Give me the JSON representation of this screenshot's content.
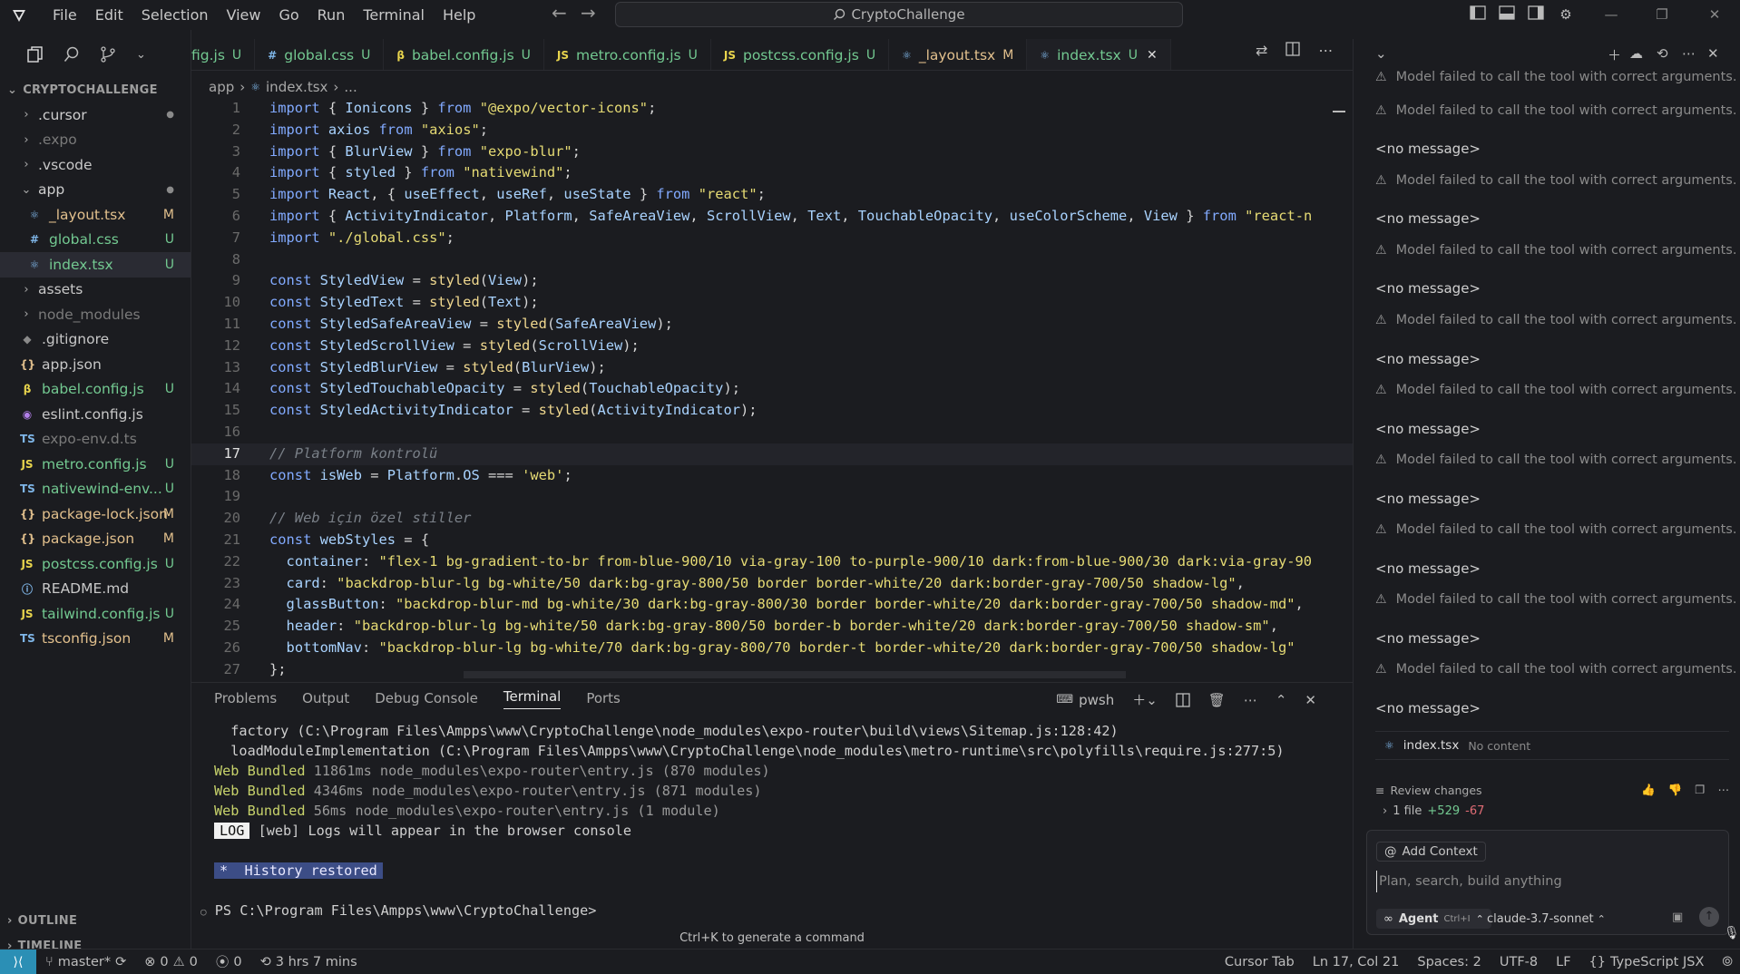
{
  "titlebar": {
    "menus": [
      "File",
      "Edit",
      "Selection",
      "View",
      "Go",
      "Run",
      "Terminal",
      "Help"
    ],
    "search_text": "CryptoChallenge"
  },
  "explorer": {
    "title": "CRYPTOCHALLENGE",
    "items": [
      {
        "label": ".cursor",
        "kind": "folder",
        "badge": "●",
        "badge_kind": "dot",
        "dim": false
      },
      {
        "label": ".expo",
        "kind": "folder",
        "badge": "",
        "dim": true
      },
      {
        "label": ".vscode",
        "kind": "folder",
        "badge": "",
        "dim": false
      },
      {
        "label": "app",
        "kind": "folder-open",
        "badge": "●",
        "badge_kind": "dot",
        "dim": false
      },
      {
        "label": "_layout.tsx",
        "kind": "tsx",
        "badge": "M",
        "badge_kind": "m",
        "indent": true
      },
      {
        "label": "global.css",
        "kind": "css",
        "badge": "U",
        "badge_kind": "u",
        "indent": true
      },
      {
        "label": "index.tsx",
        "kind": "tsx",
        "badge": "U",
        "badge_kind": "u",
        "indent": true,
        "selected": true
      },
      {
        "label": "assets",
        "kind": "folder",
        "badge": "",
        "dim": false
      },
      {
        "label": "node_modules",
        "kind": "folder",
        "badge": "",
        "dim": true
      },
      {
        "label": ".gitignore",
        "kind": "git",
        "badge": "",
        "dim": false
      },
      {
        "label": "app.json",
        "kind": "json",
        "badge": "",
        "dim": false
      },
      {
        "label": "babel.config.js",
        "kind": "babel",
        "badge": "U",
        "badge_kind": "u"
      },
      {
        "label": "eslint.config.js",
        "kind": "eslint",
        "badge": "",
        "dim": false
      },
      {
        "label": "expo-env.d.ts",
        "kind": "ts",
        "badge": "",
        "dim": true
      },
      {
        "label": "metro.config.js",
        "kind": "js",
        "badge": "U",
        "badge_kind": "u"
      },
      {
        "label": "nativewind-env...",
        "kind": "ts",
        "badge": "U",
        "badge_kind": "u"
      },
      {
        "label": "package-lock.json",
        "kind": "json",
        "badge": "M",
        "badge_kind": "m"
      },
      {
        "label": "package.json",
        "kind": "json",
        "badge": "M",
        "badge_kind": "m"
      },
      {
        "label": "postcss.config.js",
        "kind": "js",
        "badge": "U",
        "badge_kind": "u"
      },
      {
        "label": "README.md",
        "kind": "md",
        "badge": "",
        "dim": false
      },
      {
        "label": "tailwind.config.js",
        "kind": "js",
        "badge": "U",
        "badge_kind": "u"
      },
      {
        "label": "tsconfig.json",
        "kind": "tsjson",
        "badge": "M",
        "badge_kind": "m"
      }
    ],
    "outline": "OUTLINE",
    "timeline": "TIMELINE"
  },
  "tabs": [
    {
      "label": "fig.js",
      "icon": "",
      "status": "U",
      "kind": "u"
    },
    {
      "label": "global.css",
      "icon": "#",
      "status": "U",
      "kind": "u"
    },
    {
      "label": "babel.config.js",
      "icon": "β",
      "status": "U",
      "kind": "u"
    },
    {
      "label": "metro.config.js",
      "icon": "JS",
      "status": "U",
      "kind": "u"
    },
    {
      "label": "postcss.config.js",
      "icon": "JS",
      "status": "U",
      "kind": "u"
    },
    {
      "label": "_layout.tsx",
      "icon": "⚛",
      "status": "M",
      "kind": "m"
    },
    {
      "label": "index.tsx",
      "icon": "⚛",
      "status": "U",
      "kind": "u",
      "active": true
    }
  ],
  "breadcrumb": {
    "folder": "app",
    "file": "index.tsx",
    "more": "..."
  },
  "editor": {
    "current_line": 17,
    "lines": [
      [
        [
          "kw",
          "import"
        ],
        [
          "op",
          " { "
        ],
        [
          "id",
          "Ionicons"
        ],
        [
          "op",
          " } "
        ],
        [
          "kw",
          "from"
        ],
        [
          "op",
          " "
        ],
        [
          "str",
          "\"@expo/vector-icons\""
        ],
        [
          "op",
          ";"
        ]
      ],
      [
        [
          "kw",
          "import"
        ],
        [
          "op",
          " "
        ],
        [
          "id",
          "axios"
        ],
        [
          "op",
          " "
        ],
        [
          "kw",
          "from"
        ],
        [
          "op",
          " "
        ],
        [
          "str",
          "\"axios\""
        ],
        [
          "op",
          ";"
        ]
      ],
      [
        [
          "kw",
          "import"
        ],
        [
          "op",
          " { "
        ],
        [
          "id",
          "BlurView"
        ],
        [
          "op",
          " } "
        ],
        [
          "kw",
          "from"
        ],
        [
          "op",
          " "
        ],
        [
          "str",
          "\"expo-blur\""
        ],
        [
          "op",
          ";"
        ]
      ],
      [
        [
          "kw",
          "import"
        ],
        [
          "op",
          " { "
        ],
        [
          "id",
          "styled"
        ],
        [
          "op",
          " } "
        ],
        [
          "kw",
          "from"
        ],
        [
          "op",
          " "
        ],
        [
          "str",
          "\"nativewind\""
        ],
        [
          "op",
          ";"
        ]
      ],
      [
        [
          "kw",
          "import"
        ],
        [
          "op",
          " "
        ],
        [
          "id",
          "React"
        ],
        [
          "op",
          ", { "
        ],
        [
          "id",
          "useEffect"
        ],
        [
          "op",
          ", "
        ],
        [
          "id",
          "useRef"
        ],
        [
          "op",
          ", "
        ],
        [
          "id",
          "useState"
        ],
        [
          "op",
          " } "
        ],
        [
          "kw",
          "from"
        ],
        [
          "op",
          " "
        ],
        [
          "str",
          "\"react\""
        ],
        [
          "op",
          ";"
        ]
      ],
      [
        [
          "kw",
          "import"
        ],
        [
          "op",
          " { "
        ],
        [
          "id",
          "ActivityIndicator"
        ],
        [
          "op",
          ", "
        ],
        [
          "id",
          "Platform"
        ],
        [
          "op",
          ", "
        ],
        [
          "id",
          "SafeAreaView"
        ],
        [
          "op",
          ", "
        ],
        [
          "id",
          "ScrollView"
        ],
        [
          "op",
          ", "
        ],
        [
          "id",
          "Text"
        ],
        [
          "op",
          ", "
        ],
        [
          "id",
          "TouchableOpacity"
        ],
        [
          "op",
          ", "
        ],
        [
          "id",
          "useColorScheme"
        ],
        [
          "op",
          ", "
        ],
        [
          "id",
          "View"
        ],
        [
          "op",
          " } "
        ],
        [
          "kw",
          "from"
        ],
        [
          "op",
          " "
        ],
        [
          "str",
          "\"react-n"
        ]
      ],
      [
        [
          "kw",
          "import"
        ],
        [
          "op",
          " "
        ],
        [
          "str",
          "\"./global.css\""
        ],
        [
          "op",
          ";"
        ]
      ],
      [],
      [
        [
          "kw",
          "const"
        ],
        [
          "op",
          " "
        ],
        [
          "id",
          "StyledView"
        ],
        [
          "op",
          " = "
        ],
        [
          "fn",
          "styled"
        ],
        [
          "op",
          "("
        ],
        [
          "id",
          "View"
        ],
        [
          "op",
          ");"
        ]
      ],
      [
        [
          "kw",
          "const"
        ],
        [
          "op",
          " "
        ],
        [
          "id",
          "StyledText"
        ],
        [
          "op",
          " = "
        ],
        [
          "fn",
          "styled"
        ],
        [
          "op",
          "("
        ],
        [
          "id",
          "Text"
        ],
        [
          "op",
          ");"
        ]
      ],
      [
        [
          "kw",
          "const"
        ],
        [
          "op",
          " "
        ],
        [
          "id",
          "StyledSafeAreaView"
        ],
        [
          "op",
          " = "
        ],
        [
          "fn",
          "styled"
        ],
        [
          "op",
          "("
        ],
        [
          "id",
          "SafeAreaView"
        ],
        [
          "op",
          ");"
        ]
      ],
      [
        [
          "kw",
          "const"
        ],
        [
          "op",
          " "
        ],
        [
          "id",
          "StyledScrollView"
        ],
        [
          "op",
          " = "
        ],
        [
          "fn",
          "styled"
        ],
        [
          "op",
          "("
        ],
        [
          "id",
          "ScrollView"
        ],
        [
          "op",
          ");"
        ]
      ],
      [
        [
          "kw",
          "const"
        ],
        [
          "op",
          " "
        ],
        [
          "id",
          "StyledBlurView"
        ],
        [
          "op",
          " = "
        ],
        [
          "fn",
          "styled"
        ],
        [
          "op",
          "("
        ],
        [
          "id",
          "BlurView"
        ],
        [
          "op",
          ");"
        ]
      ],
      [
        [
          "kw",
          "const"
        ],
        [
          "op",
          " "
        ],
        [
          "id",
          "StyledTouchableOpacity"
        ],
        [
          "op",
          " = "
        ],
        [
          "fn",
          "styled"
        ],
        [
          "op",
          "("
        ],
        [
          "id",
          "TouchableOpacity"
        ],
        [
          "op",
          ");"
        ]
      ],
      [
        [
          "kw",
          "const"
        ],
        [
          "op",
          " "
        ],
        [
          "id",
          "StyledActivityIndicator"
        ],
        [
          "op",
          " = "
        ],
        [
          "fn",
          "styled"
        ],
        [
          "op",
          "("
        ],
        [
          "id",
          "ActivityIndicator"
        ],
        [
          "op",
          ");"
        ]
      ],
      [],
      [
        [
          "cm",
          "// Platform kontrolü"
        ]
      ],
      [
        [
          "kw",
          "const"
        ],
        [
          "op",
          " "
        ],
        [
          "id",
          "isWeb"
        ],
        [
          "op",
          " = "
        ],
        [
          "id",
          "Platform"
        ],
        [
          "op",
          "."
        ],
        [
          "id",
          "OS"
        ],
        [
          "op",
          " === "
        ],
        [
          "str",
          "'web'"
        ],
        [
          "op",
          ";"
        ]
      ],
      [],
      [
        [
          "cm",
          "// Web için özel stiller"
        ]
      ],
      [
        [
          "kw",
          "const"
        ],
        [
          "op",
          " "
        ],
        [
          "id",
          "webStyles"
        ],
        [
          "op",
          " = {"
        ]
      ],
      [
        [
          "op",
          "  "
        ],
        [
          "id",
          "container"
        ],
        [
          "op",
          ": "
        ],
        [
          "str",
          "\"flex-1 bg-gradient-to-br from-blue-900/10 via-gray-100 to-purple-900/10 dark:from-blue-900/30 dark:via-gray-90"
        ]
      ],
      [
        [
          "op",
          "  "
        ],
        [
          "id",
          "card"
        ],
        [
          "op",
          ": "
        ],
        [
          "str",
          "\"backdrop-blur-lg bg-white/50 dark:bg-gray-800/50 border border-white/20 dark:border-gray-700/50 shadow-lg\""
        ],
        [
          "op",
          ","
        ]
      ],
      [
        [
          "op",
          "  "
        ],
        [
          "id",
          "glassButton"
        ],
        [
          "op",
          ": "
        ],
        [
          "str",
          "\"backdrop-blur-md bg-white/30 dark:bg-gray-800/30 border border-white/20 dark:border-gray-700/50 shadow-md\""
        ],
        [
          "op",
          ","
        ]
      ],
      [
        [
          "op",
          "  "
        ],
        [
          "id",
          "header"
        ],
        [
          "op",
          ": "
        ],
        [
          "str",
          "\"backdrop-blur-lg bg-white/50 dark:bg-gray-800/50 border-b border-white/20 dark:border-gray-700/50 shadow-sm\""
        ],
        [
          "op",
          ","
        ]
      ],
      [
        [
          "op",
          "  "
        ],
        [
          "id",
          "bottomNav"
        ],
        [
          "op",
          ": "
        ],
        [
          "str",
          "\"backdrop-blur-lg bg-white/70 dark:bg-gray-800/70 border-t border-white/20 dark:border-gray-700/50 shadow-lg\""
        ]
      ],
      [
        [
          "op",
          "};"
        ]
      ]
    ]
  },
  "panel": {
    "tabs": [
      "Problems",
      "Output",
      "Debug Console",
      "Terminal",
      "Ports"
    ],
    "active_tab": "Terminal",
    "shell": "pwsh",
    "terminal": {
      "line1": "  factory (C:\\Program Files\\Ampps\\www\\CryptoChallenge\\node_modules\\expo-router\\build\\views\\Sitemap.js:128:42)",
      "line2": "  loadModuleImplementation (C:\\Program Files\\Ampps\\www\\CryptoChallenge\\node_modules\\metro-runtime\\src\\polyfills\\require.js:277:5)",
      "bundles": [
        {
          "label": "Web Bundled",
          "time": "11861ms",
          "rest": "node_modules\\expo-router\\entry.js (870 modules)"
        },
        {
          "label": "Web Bundled",
          "time": "4346ms",
          "rest": "node_modules\\expo-router\\entry.js (871 modules)"
        },
        {
          "label": "Web Bundled",
          "time": "56ms",
          "rest": "node_modules\\expo-router\\entry.js (1 module)"
        }
      ],
      "log_tag": "LOG",
      "log_text": "[web] Logs will appear in the browser console",
      "history_tag": "*",
      "history_text": "History restored",
      "prompt": "PS C:\\Program Files\\Ampps\\www\\CryptoChallenge>"
    },
    "hint": "Ctrl+K to generate a command"
  },
  "chat": {
    "error_text": "Model failed to call the tool with correct arguments.",
    "no_message_text": "<no message>",
    "file_chip": {
      "name": "index.tsx",
      "status": "No content"
    },
    "review": {
      "label": "Review changes",
      "summary": "1 file",
      "added": "+529",
      "removed": "-67"
    },
    "composer": {
      "add_context": "Add Context",
      "placeholder": "Plan, search, build anything",
      "agent_label": "Agent",
      "agent_shortcut": "Ctrl+I",
      "model": "claude-3.7-sonnet"
    }
  },
  "statusbar": {
    "branch": "master*",
    "errors": "0",
    "warnings": "0",
    "ports": "0",
    "time": "3 hrs 7 mins",
    "cursor_tab": "Cursor Tab",
    "position": "Ln 17, Col 21",
    "spaces": "Spaces: 2",
    "encoding": "UTF-8",
    "eol": "LF",
    "language": "TypeScript JSX"
  }
}
